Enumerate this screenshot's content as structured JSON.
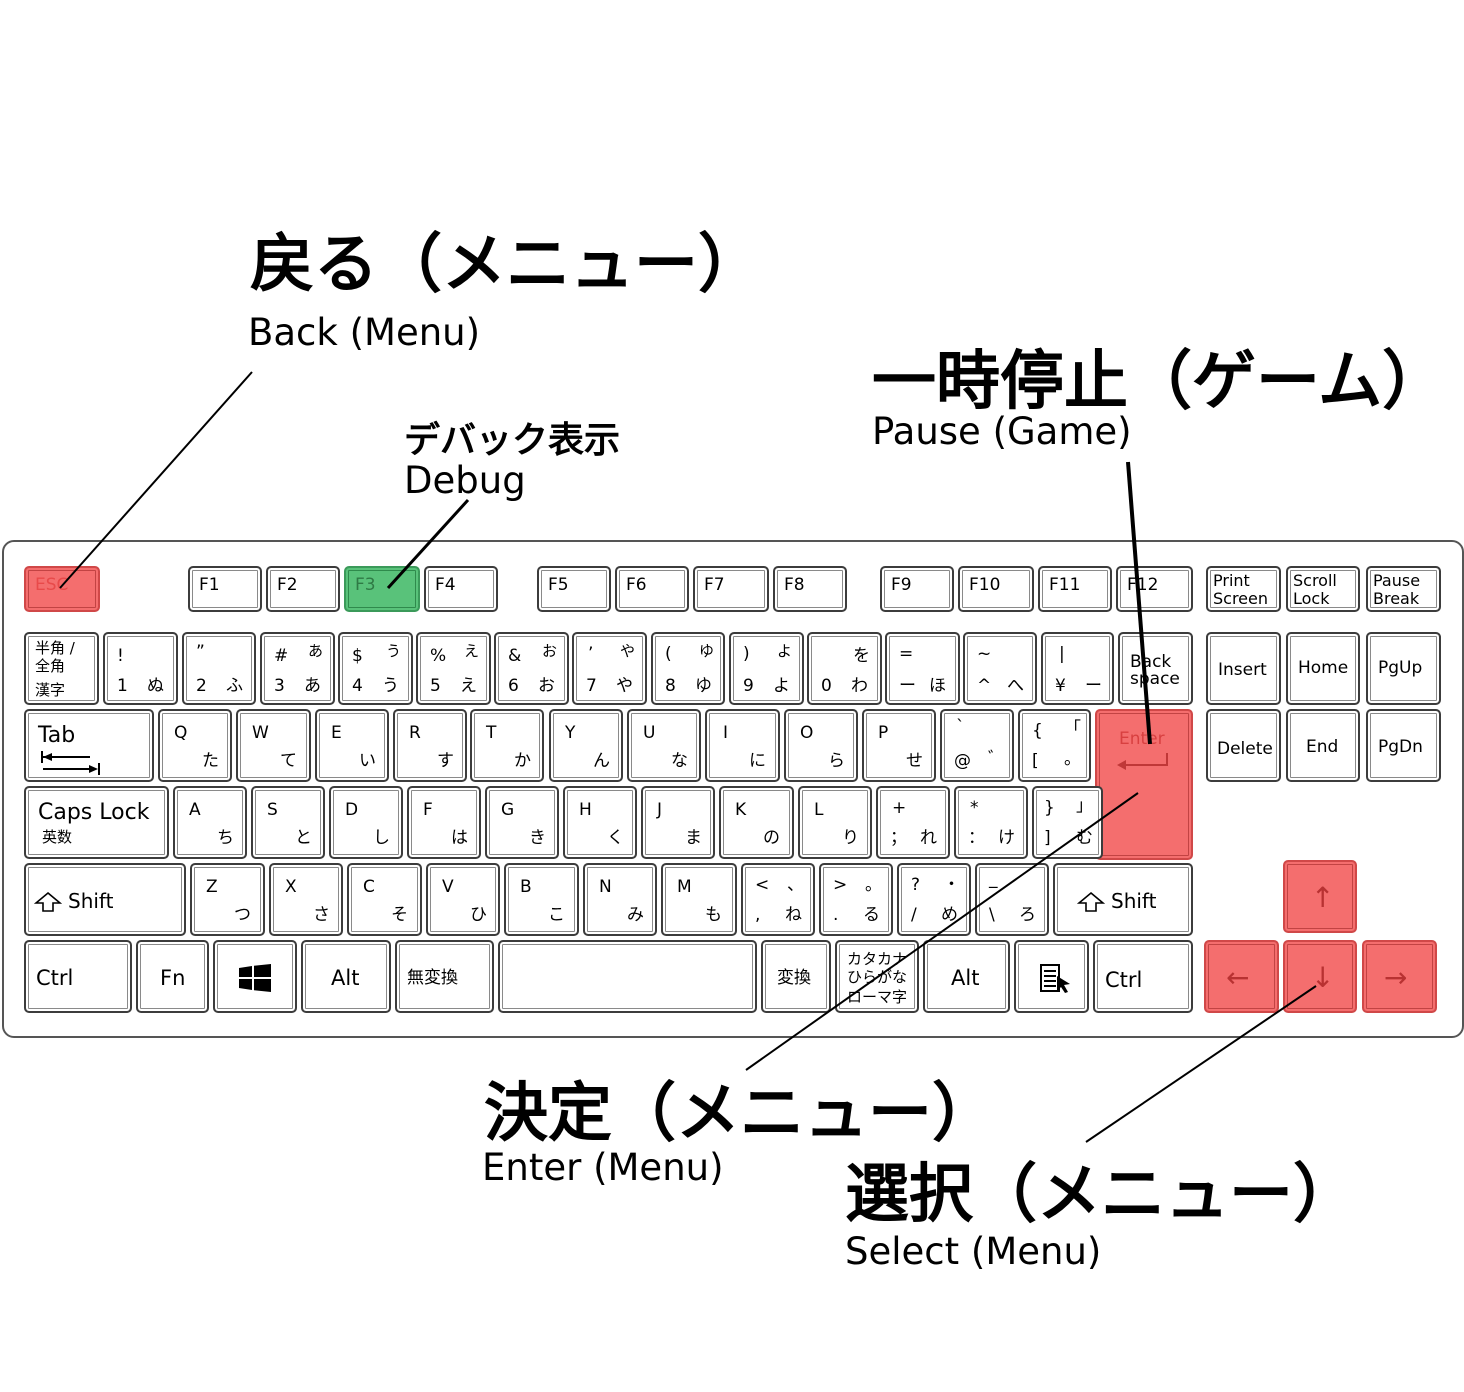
{
  "annotations": {
    "back": {
      "jp": "戻る（メニュー）",
      "en": "Back (Menu)"
    },
    "debug": {
      "jp": "デバック表示",
      "en": "Debug"
    },
    "pause": {
      "jp": "一時停止（ゲーム）",
      "en": "Pause (Game)"
    },
    "enter": {
      "jp": "決定（メニュー）",
      "en": "Enter (Menu)"
    },
    "select": {
      "jp": "選択（メニュー）",
      "en": "Select (Menu)"
    }
  },
  "keys": {
    "esc": "ESC",
    "f": [
      "F1",
      "F2",
      "F3",
      "F4",
      "F5",
      "F6",
      "F7",
      "F8",
      "F9",
      "F10",
      "F11",
      "F12"
    ],
    "print": [
      "Print",
      "Screen"
    ],
    "scroll": [
      "Scroll",
      "Lock"
    ],
    "pause": [
      "Pause",
      "Break"
    ],
    "hankaku": [
      "半角 /",
      "全角",
      "漢字"
    ],
    "num_row": [
      [
        "!",
        "",
        "1",
        "ぬ"
      ],
      [
        "”",
        "",
        "2",
        "ふ"
      ],
      [
        "#",
        "あ",
        "3",
        "あ"
      ],
      [
        "$",
        "う",
        "4",
        "う"
      ],
      [
        "%",
        "え",
        "5",
        "え"
      ],
      [
        "&",
        "お",
        "6",
        "お"
      ],
      [
        "’",
        "や",
        "7",
        "や"
      ],
      [
        "(",
        "ゆ",
        "8",
        "ゆ"
      ],
      [
        ")",
        "よ",
        "9",
        "よ"
      ],
      [
        "",
        "を",
        "0",
        "わ"
      ],
      [
        "=",
        "",
        "ー",
        "ほ"
      ],
      [
        "~",
        "",
        "^",
        "へ"
      ],
      [
        "|",
        "",
        "¥",
        "ー"
      ]
    ],
    "backspace": [
      "Back",
      "space"
    ],
    "insert": "Insert",
    "home": "Home",
    "pgup": "PgUp",
    "tab": "Tab",
    "q_row": [
      [
        "Q",
        "た"
      ],
      [
        "W",
        "て"
      ],
      [
        "E",
        "い"
      ],
      [
        "R",
        "す"
      ],
      [
        "T",
        "か"
      ],
      [
        "Y",
        "ん"
      ],
      [
        "U",
        "な"
      ],
      [
        "I",
        "に"
      ],
      [
        "O",
        "ら"
      ],
      [
        "P",
        "せ"
      ]
    ],
    "at_key": [
      "`",
      "@",
      "゛"
    ],
    "bracket_key": [
      "{",
      "「",
      "[",
      "。"
    ],
    "enter": "Enter",
    "delete": "Delete",
    "end": "End",
    "pgdn": "PgDn",
    "caps": [
      "Caps Lock",
      "英数"
    ],
    "a_row": [
      [
        "A",
        "ち"
      ],
      [
        "S",
        "と"
      ],
      [
        "D",
        "し"
      ],
      [
        "F",
        "は"
      ],
      [
        "G",
        "き"
      ],
      [
        "H",
        "く"
      ],
      [
        "J",
        "ま"
      ],
      [
        "K",
        "の"
      ],
      [
        "L",
        "り"
      ]
    ],
    "semi_key": [
      "+",
      "；",
      "れ"
    ],
    "colon_key": [
      "*",
      "：",
      "け"
    ],
    "close_key": [
      "}",
      "」",
      "]",
      "む"
    ],
    "shift": "Shift",
    "z_row": [
      [
        "Z",
        "つ"
      ],
      [
        "X",
        "さ"
      ],
      [
        "C",
        "そ"
      ],
      [
        "V",
        "ひ"
      ],
      [
        "B",
        "こ"
      ],
      [
        "N",
        "み"
      ],
      [
        "M",
        "も"
      ]
    ],
    "comma_key": [
      "<",
      "、",
      ",",
      "ね"
    ],
    "period_key": [
      ">",
      "。",
      ".",
      "る"
    ],
    "slash_key": [
      "?",
      "・",
      "/",
      "め"
    ],
    "backslash_key": [
      "_",
      "",
      "\\",
      "ろ"
    ],
    "ctrl": "Ctrl",
    "fn": "Fn",
    "alt": "Alt",
    "muhenkan": "無変換",
    "henkan": "変換",
    "kana": [
      "カタカナ",
      "ひらがな",
      "ローマ字"
    ],
    "arrows": {
      "up": "↑",
      "down": "↓",
      "left": "←",
      "right": "→"
    }
  },
  "colors": {
    "highlight_red": "#f46e6e",
    "highlight_green": "#59c27a"
  }
}
